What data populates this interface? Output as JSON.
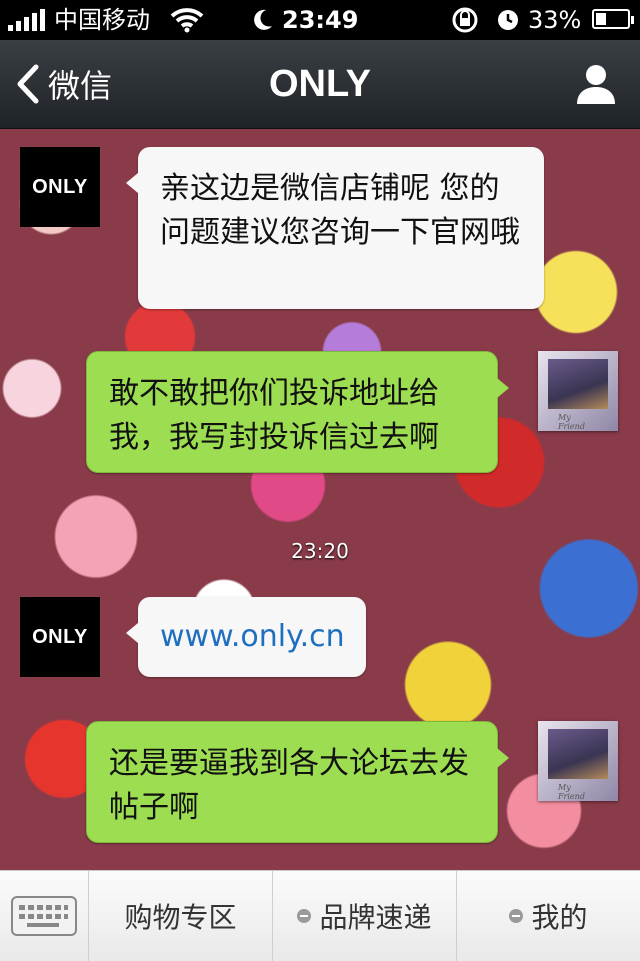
{
  "status_bar": {
    "carrier": "中国移动",
    "time": "23:49",
    "battery": "33%",
    "battery_level": 0.33
  },
  "nav": {
    "back_label": "微信",
    "title": "ONLY",
    "profile_icon": "person-icon"
  },
  "messages": [
    {
      "side": "in",
      "avatar_text": "ONLY",
      "text": "亲这边是微信店铺呢 您的问题建议您咨询一下官网哦"
    },
    {
      "side": "out",
      "text": "敢不敢把你们投诉地址给我，我写封投诉信过去啊"
    },
    {
      "side": "in",
      "avatar_text": "ONLY",
      "text": "www.only.cn"
    },
    {
      "side": "out",
      "text": "还是要逼我到各大论坛去发帖子啊"
    }
  ],
  "timestamp": "23:20",
  "bottom_menu": {
    "keyboard_icon": "keyboard-icon",
    "items": [
      "购物专区",
      "品牌速递",
      "我的"
    ]
  },
  "colors": {
    "nav_bg": "#2b2f33",
    "bubble_out": "#9ddd51",
    "bubble_in": "#f7f7f7",
    "link": "#1f6fc0"
  }
}
